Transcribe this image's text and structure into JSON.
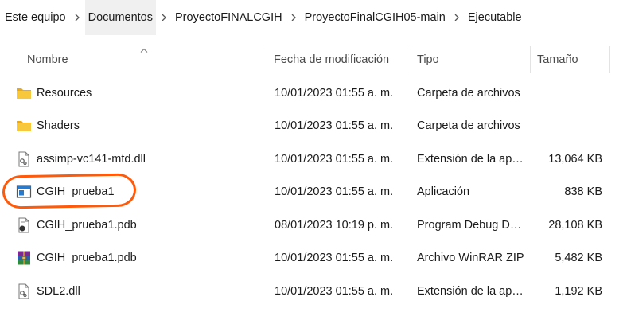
{
  "breadcrumb": {
    "items": [
      "Este equipo",
      "Documentos",
      "ProyectoFINALCGIH",
      "ProyectoFinalCGIH05-main",
      "Ejecutable"
    ]
  },
  "columns": {
    "name": "Nombre",
    "date": "Fecha de modificación",
    "type": "Tipo",
    "size": "Tamaño",
    "sort_column": "Nombre",
    "sort_direction": "ascending"
  },
  "files": [
    {
      "name": "Resources",
      "date": "10/01/2023 01:55 a. m.",
      "type": "Carpeta de archivos",
      "size": "",
      "icon": "folder-icon"
    },
    {
      "name": "Shaders",
      "date": "10/01/2023 01:55 a. m.",
      "type": "Carpeta de archivos",
      "size": "",
      "icon": "folder-icon"
    },
    {
      "name": "assimp-vc141-mtd.dll",
      "date": "10/01/2023 01:55 a. m.",
      "type": "Extensión de la ap…",
      "size": "13,064 KB",
      "icon": "dll-icon"
    },
    {
      "name": "CGIH_prueba1",
      "date": "10/01/2023 01:55 a. m.",
      "type": "Aplicación",
      "size": "838 KB",
      "icon": "application-icon"
    },
    {
      "name": "CGIH_prueba1.pdb",
      "date": "08/01/2023 10:19 p. m.",
      "type": "Program Debug D…",
      "size": "28,108 KB",
      "icon": "pdb-icon"
    },
    {
      "name": "CGIH_prueba1.pdb",
      "date": "10/01/2023 01:55 a. m.",
      "type": "Archivo WinRAR ZIP",
      "size": "5,482 KB",
      "icon": "winrar-icon"
    },
    {
      "name": "SDL2.dll",
      "date": "10/01/2023 01:55 a. m.",
      "type": "Extensión de la ap…",
      "size": "1,192 KB",
      "icon": "dll-icon"
    }
  ],
  "colors": {
    "annotation": "#ff5a0a",
    "folder": "#f8c83c"
  }
}
